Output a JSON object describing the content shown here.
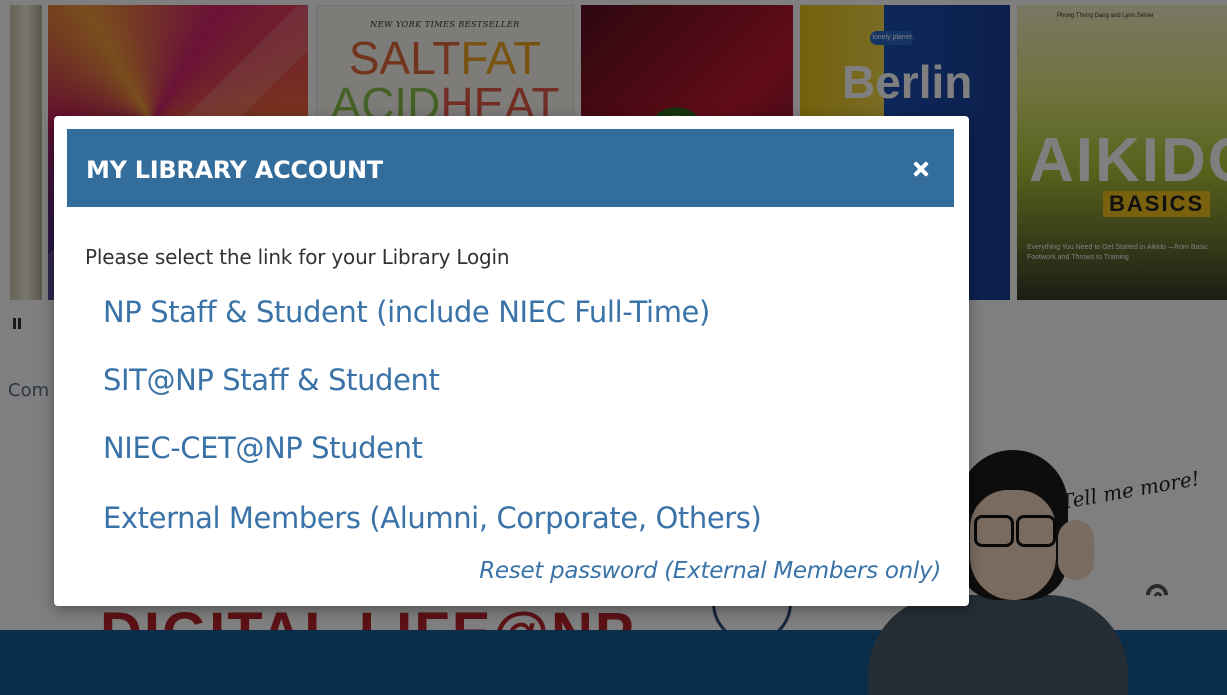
{
  "background": {
    "books": [
      {
        "name": "abstract-cover"
      },
      {
        "nyt_label": "NEW YORK TIMES BESTSELLER",
        "title_line1a": "SALT",
        "title_line1b": "FAT",
        "title_line2a": "ACID",
        "title_line2b": "HEAT"
      },
      {
        "name": "virus-cover"
      },
      {
        "publisher": "lonely planet",
        "title": "Berlin"
      },
      {
        "author": "Phong Thong Dang and Lynn Seiser",
        "title": "AIKIDO",
        "subtitle": "BASICS",
        "tagline": "Everything You Need to Get Started in Aikido —from Basic Footwork and Throws to Training"
      }
    ],
    "partial_text": "Com",
    "promo_title": "DIGITAL LIFE@NP",
    "speech_text": "Tell me more!"
  },
  "modal": {
    "title": "MY LIBRARY ACCOUNT",
    "instruction": "Please select the link for your Library Login",
    "links": [
      "NP Staff & Student (include NIEC Full-Time)",
      "SIT@NP Staff & Student",
      "NIEC-CET@NP Student",
      "External Members (Alumni, Corporate, Others)"
    ],
    "reset_label": "Reset password (External Members only)"
  },
  "colors": {
    "header_bg": "#336d9c",
    "link": "#3a73a8",
    "footer_band": "#145a94"
  }
}
